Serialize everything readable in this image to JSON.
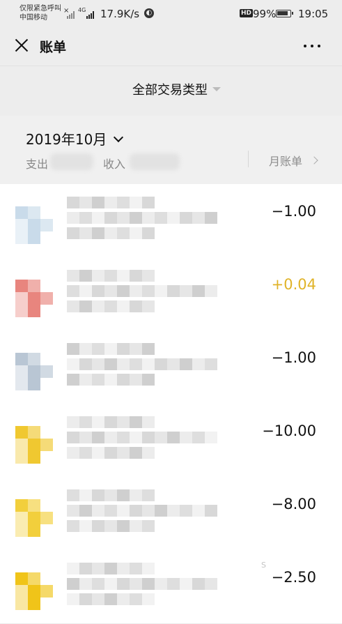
{
  "status_bar": {
    "carrier_line1": "仅限紧急呼叫",
    "carrier_line2": "中国移动",
    "network_type": "4G",
    "speed": "17.9K/s",
    "hd_badge": "HD",
    "battery": "99%",
    "time": "19:05"
  },
  "nav": {
    "title": "账单",
    "close_icon": "close-icon",
    "more_icon": "more-icon"
  },
  "filter": {
    "label": "全部交易类型",
    "caret_icon": "caret-down-icon"
  },
  "summary": {
    "month": "2019年10月",
    "expense_label": "支出",
    "income_label": "收入",
    "monthly_bill_label": "月账单"
  },
  "transactions": [
    {
      "amount": "−1.00",
      "type": "expense",
      "avatar_color": "#c9dbea"
    },
    {
      "amount": "+0.04",
      "type": "income",
      "avatar_color": "#e8857e"
    },
    {
      "amount": "−1.00",
      "type": "expense",
      "avatar_color": "#b9c6d4"
    },
    {
      "amount": "−10.00",
      "type": "expense",
      "avatar_color": "#f0c830"
    },
    {
      "amount": "−8.00",
      "type": "expense",
      "avatar_color": "#f2cf3c"
    },
    {
      "amount": "−2.50",
      "type": "expense",
      "avatar_color": "#f0c419"
    }
  ],
  "colors": {
    "background": "#ededed",
    "income": "#e0b328",
    "expense": "#111111"
  }
}
